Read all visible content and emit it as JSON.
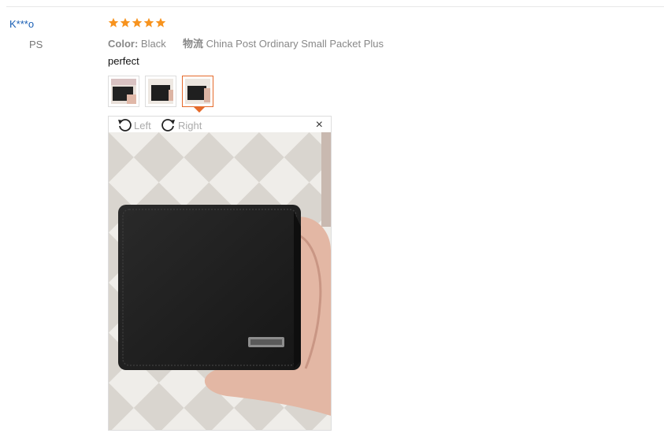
{
  "review": {
    "user_name": "K***o",
    "country": "PS",
    "rating": 5,
    "rating_max": 5,
    "color_label": "Color:",
    "color_value": "Black",
    "shipping_label": "物流",
    "shipping_value": "China Post Ordinary Small Packet Plus",
    "text": "perfect",
    "thumbnails_count": 3,
    "active_thumbnail_index": 2
  },
  "viewer": {
    "rotate_left_label": "Left",
    "rotate_right_label": "Right",
    "close_label": "×"
  },
  "colors": {
    "star": "#f7931e",
    "user_link": "#1a5fb4",
    "active_border": "#e56a2a"
  }
}
